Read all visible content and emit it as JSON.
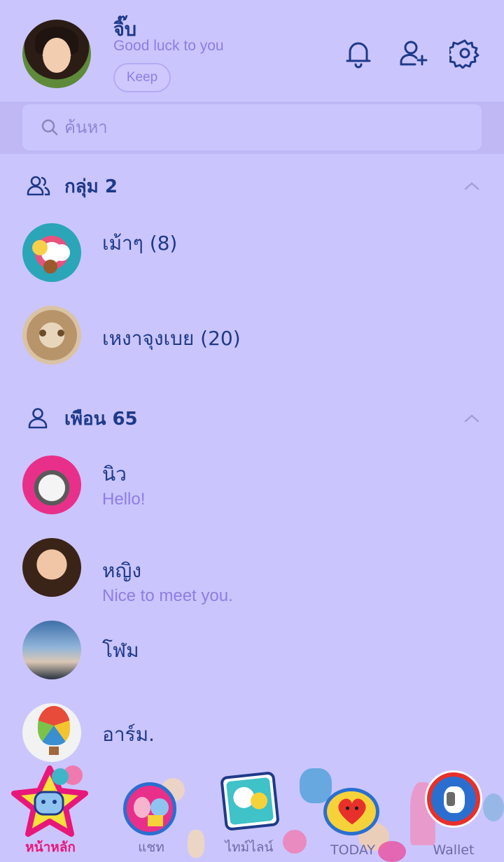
{
  "profile": {
    "name": "จิ๊บ",
    "status": "Good luck to you",
    "keep_label": "Keep"
  },
  "header_icons": [
    "bell-icon",
    "add-friend-icon",
    "settings-icon"
  ],
  "search": {
    "placeholder": "ค้นหา"
  },
  "groups": {
    "title": "กลุ่ม 2",
    "items": [
      {
        "name": "เม้าๆ (8)"
      },
      {
        "name": "เหงาจุงเบย (20)"
      }
    ]
  },
  "friends": {
    "title": "เพือน 65",
    "items": [
      {
        "name": "นิว",
        "status": "Hello!"
      },
      {
        "name": "หญิง",
        "status": "Nice to meet you."
      },
      {
        "name": "โฬม",
        "status": ""
      },
      {
        "name": "อาร์ม.",
        "status": ""
      }
    ]
  },
  "nav": {
    "items": [
      {
        "label": "หน้าหลัก",
        "active": true
      },
      {
        "label": "แชท",
        "active": false
      },
      {
        "label": "ไทม์ไลน์",
        "active": false
      },
      {
        "label": "TODAY",
        "active": false
      },
      {
        "label": "Wallet",
        "active": false
      }
    ]
  },
  "colors": {
    "background": "#cbc5fd",
    "text_primary": "#1e3a8a",
    "text_secondary": "#8a7fe6",
    "active_nav": "#e8177a"
  }
}
